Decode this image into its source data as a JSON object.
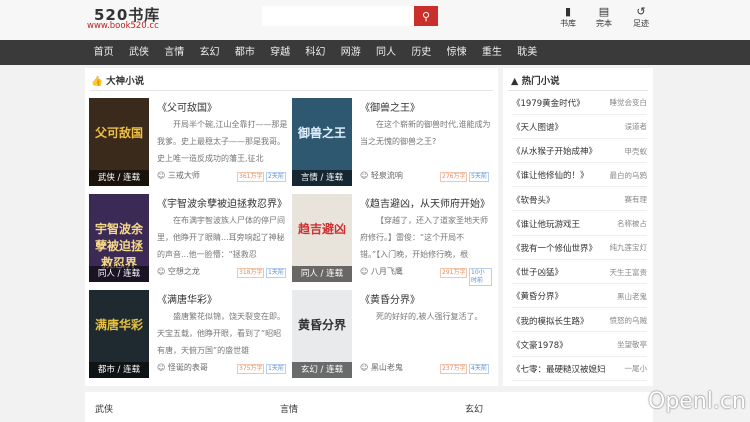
{
  "header": {
    "logo": "520书库",
    "url": "www.book520.cc",
    "search_placeholder": "",
    "icons": [
      {
        "icon": "book-icon",
        "label": "书库"
      },
      {
        "icon": "cup-icon",
        "label": "完本"
      },
      {
        "icon": "history-icon",
        "label": "足迹"
      }
    ]
  },
  "nav": [
    "首页",
    "武侠",
    "言情",
    "玄幻",
    "都市",
    "穿越",
    "科幻",
    "网游",
    "同人",
    "历史",
    "惊悚",
    "重生",
    "耽美"
  ],
  "main": {
    "title": "大神小说",
    "books": [
      {
        "title": "《父可敌国》",
        "cover_text": "父可敌国",
        "category": "武侠 / 连载",
        "desc": "开局半个碗,江山全靠打——那是我爹。史上最稳太子——那是我哥。史上唯一造反成功的藩王,征北",
        "author": "三戒大师",
        "words": "361万字",
        "updated": "2天前",
        "bg": "#3a2a1c",
        "fg": "#f0c040"
      },
      {
        "title": "《御兽之王》",
        "cover_text": "御兽之王",
        "category": "言情 / 连载",
        "desc": "在这个崭新的御兽时代,谁能成为当之无愧的御兽之王?",
        "author": "轻泉流响",
        "words": "276万字",
        "updated": "5天前",
        "bg": "#2e5870",
        "fg": "#e0f0ff"
      },
      {
        "title": "《宇智波余孽被迫拯救忍界》",
        "cover_text": "宇智波余孽被迫拯救忍界",
        "category": "同人 / 连载",
        "desc": "在布满宇智波族人尸体的停尸间里，他睁开了眼睛...耳旁响起了神秘的声音...他一脸懵：“拯救忍",
        "author": "空想之龙",
        "words": "318万字",
        "updated": "1天前",
        "bg": "#3a2a55",
        "fg": "#f5d88a"
      },
      {
        "title": "《趋吉避凶，从天师府开始》",
        "cover_text": "趋吉避凶",
        "category": "同人 / 连载",
        "desc": "【穿越了，还入了道家圣地天师府修行。】雷俊：“这个开局不错。”【入门晚，开始修行晚，根",
        "author": "八月飞鹰",
        "words": "291万字",
        "updated": "10小时前",
        "bg": "#e8e4dc",
        "fg": "#d03030"
      },
      {
        "title": "《满唐华彩》",
        "cover_text": "满唐华彩",
        "category": "都市 / 连载",
        "desc": "盛唐繁花似锦，饶天裂变在即。天宝五载，他睁开眼，看到了“昭昭有唐，天俯万国”的盛世雄",
        "author": "怪诞的表哥",
        "words": "375万字",
        "updated": "1天前",
        "bg": "#1f2a30",
        "fg": "#e6c040"
      },
      {
        "title": "《黄昏分界》",
        "cover_text": "黄昏分界",
        "category": "玄幻 / 连载",
        "desc": "死的好好的,被人强行复活了。",
        "author": "黑山老鬼",
        "words": "237万字",
        "updated": "4天前",
        "bg": "#e8eaec",
        "fg": "#333"
      }
    ]
  },
  "side": {
    "title": "热门小说",
    "items": [
      {
        "name": "《1979黄金时代》",
        "author": "睡觉会变白"
      },
      {
        "name": "《天人图谱》",
        "author": "误道者"
      },
      {
        "name": "《从水猴子开始成神》",
        "author": "甲壳蚁"
      },
      {
        "name": "《谁让他修仙的！》",
        "author": "最白的乌鸦"
      },
      {
        "name": "《软骨头》",
        "author": "赛有理"
      },
      {
        "name": "《谁让他玩游戏王",
        "author": "名称被占"
      },
      {
        "name": "《我有一个修仙世界》",
        "author": "纯九莲宝灯"
      },
      {
        "name": "《世子凶猛》",
        "author": "天生王富贵"
      },
      {
        "name": "《黄昏分界》",
        "author": "黑山老鬼"
      },
      {
        "name": "《我的模拟长生路》",
        "author": "愤怒的乌贼"
      },
      {
        "name": "《文豪1978》",
        "author": "坐望敬亭"
      },
      {
        "name": "《七零：最硬糙汉被媳妇",
        "author": "一尾小"
      }
    ]
  },
  "bottom": [
    "武侠",
    "言情",
    "玄幻"
  ],
  "watermark": "Openl.cn"
}
